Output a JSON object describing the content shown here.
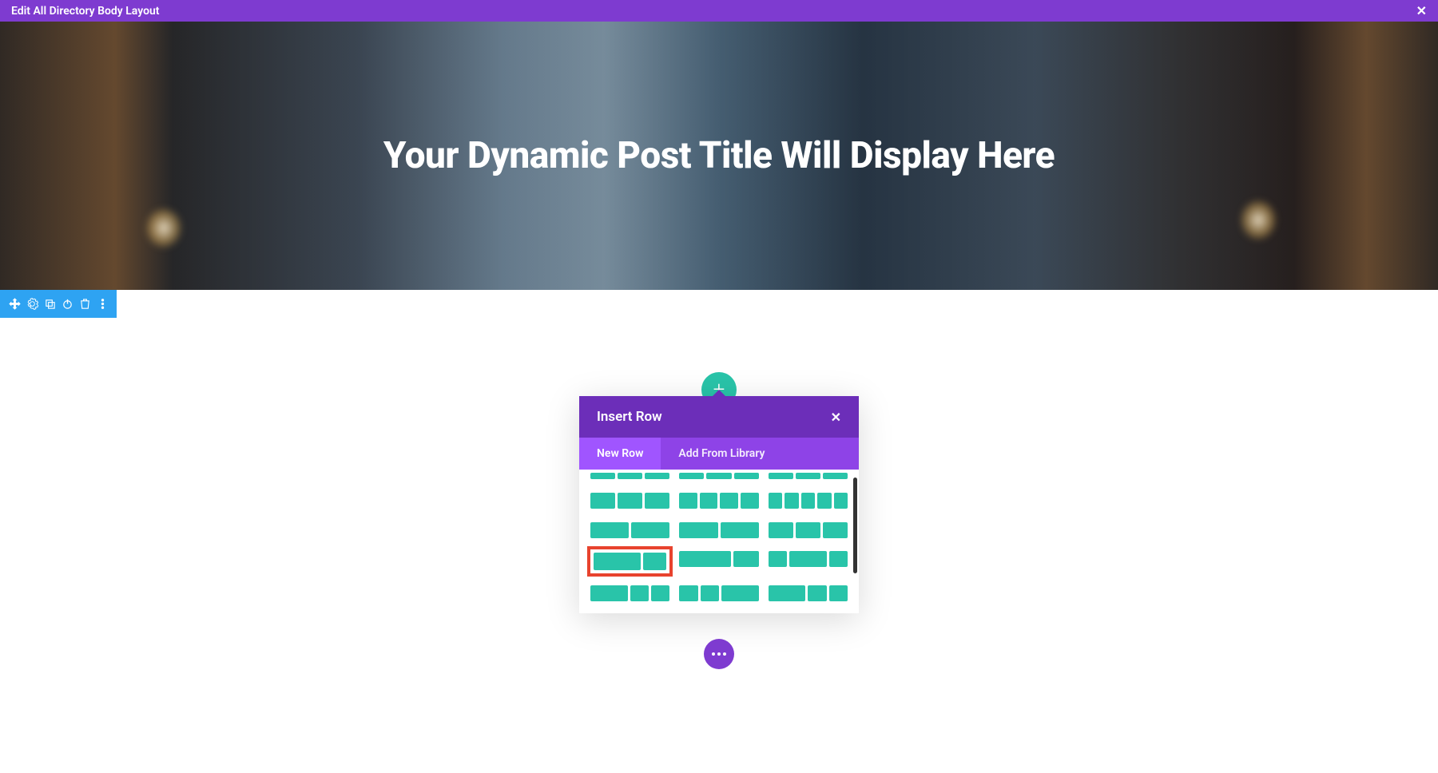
{
  "topbar": {
    "title": "Edit All Directory Body Layout",
    "close_glyph": "✕"
  },
  "hero": {
    "title": "Your Dynamic Post Title Will Display Here"
  },
  "section_toolbar": {
    "icons": [
      "move-icon",
      "gear-icon",
      "duplicate-icon",
      "power-icon",
      "trash-icon",
      "more-icon"
    ]
  },
  "add_button": {
    "glyph": "+"
  },
  "modal": {
    "title": "Insert Row",
    "close_glyph": "✕",
    "tabs": [
      {
        "label": "New Row",
        "active": true
      },
      {
        "label": "Add From Library",
        "active": false
      }
    ],
    "layouts_row_partial": [
      {
        "cols": [
          1,
          1,
          1
        ],
        "partial": true
      },
      {
        "cols": [
          1,
          1,
          1
        ],
        "partial": true
      },
      {
        "cols": [
          1,
          1,
          1
        ],
        "partial": true
      }
    ],
    "layouts": [
      {
        "cols": [
          1,
          1,
          1
        ]
      },
      {
        "cols": [
          1,
          1,
          1,
          1
        ]
      },
      {
        "cols": [
          1,
          1,
          1,
          1,
          1
        ]
      },
      {
        "cols": [
          1,
          1
        ]
      },
      {
        "cols": [
          1,
          1
        ]
      },
      {
        "cols": [
          1,
          1,
          1
        ]
      },
      {
        "cols": [
          2,
          1
        ],
        "highlighted": true
      },
      {
        "cols": [
          2,
          1
        ]
      },
      {
        "cols": [
          1,
          2,
          1
        ]
      },
      {
        "cols": [
          2,
          1,
          1
        ]
      },
      {
        "cols": [
          1,
          1,
          2
        ]
      },
      {
        "cols": [
          2,
          1,
          1
        ]
      }
    ]
  },
  "fab": {
    "name": "more-actions"
  }
}
